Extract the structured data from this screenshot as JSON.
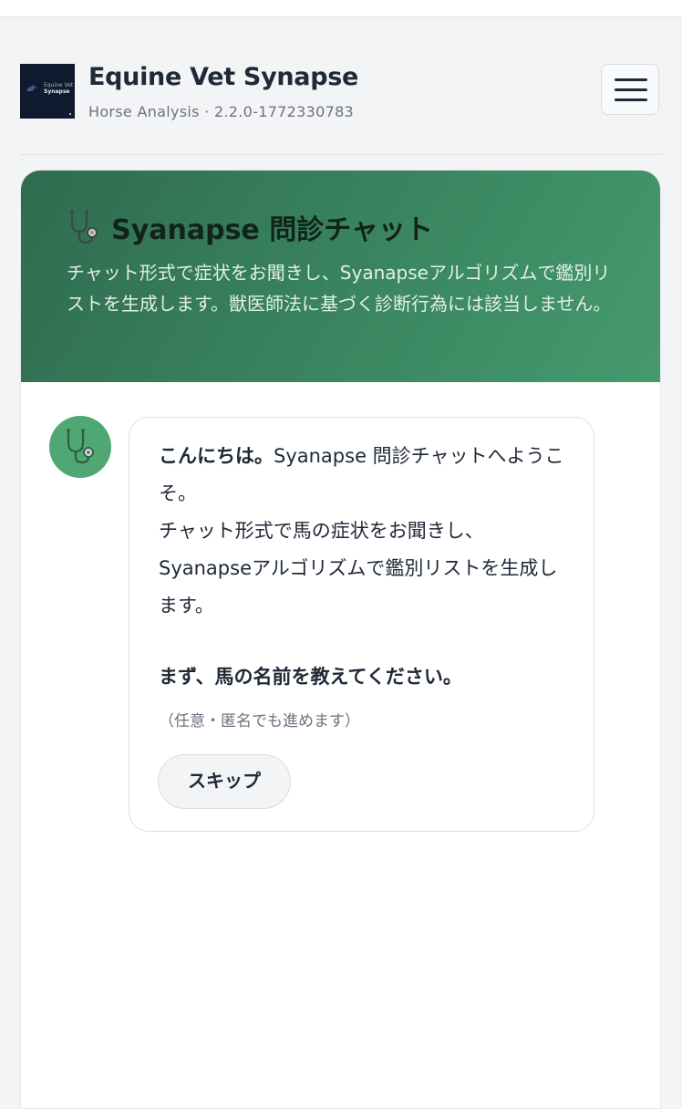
{
  "header": {
    "logo": {
      "line1": "Equine Vet",
      "line2": "Synapse"
    },
    "title": "Equine Vet Synapse",
    "subtitle": "Horse Analysis · 2.2.0-1772330783",
    "menu_icon": "hamburger-menu-icon"
  },
  "chat": {
    "banner": {
      "icon": "stethoscope-icon",
      "title": "Syanapse 問診チャット",
      "description": "チャット形式で症状をお聞きし、Syanapseアルゴリズムで鑑別リストを生成します。獣医師法に基づく診断行為には該当しません。"
    },
    "assistant_avatar_icon": "stethoscope-icon",
    "message": {
      "greeting": "こんにちは。",
      "line1_rest": "Syanapse 問診チャットへようこそ。",
      "line2": "チャット形式で馬の症状をお聞きし、",
      "line3": "Syanapseアルゴリズムで鑑別リストを生成します。",
      "question": "まず、馬の名前を教えてください。",
      "note": "（任意・匿名でも進めます）",
      "skip_label": "スキップ"
    }
  },
  "colors": {
    "banner_gradient_start": "#2f6b50",
    "banner_gradient_end": "#469a6e",
    "avatar_green": "#4fa873",
    "page_background": "#f3f4f6"
  }
}
